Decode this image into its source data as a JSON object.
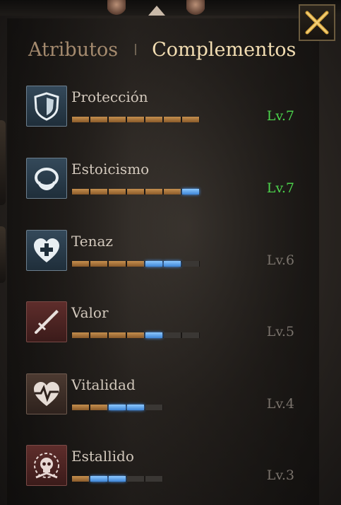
{
  "tabs": [
    {
      "label": "Atributos",
      "active": false
    },
    {
      "label": "Complementos",
      "active": true
    }
  ],
  "skills": [
    {
      "name": "Protección",
      "level": "Lv.7",
      "icon": "shield-icon",
      "theme": "blue",
      "gold": 7,
      "blue": 0,
      "total": 7,
      "maxed": true
    },
    {
      "name": "Estoicismo",
      "level": "Lv.7",
      "icon": "ring-icon",
      "theme": "blue",
      "gold": 6,
      "blue": 1,
      "total": 7,
      "maxed": true
    },
    {
      "name": "Tenaz",
      "level": "Lv.6",
      "icon": "heart-plus-icon",
      "theme": "blue",
      "gold": 4,
      "blue": 2,
      "total": 7,
      "maxed": false
    },
    {
      "name": "Valor",
      "level": "Lv.5",
      "icon": "sword-icon",
      "theme": "red",
      "gold": 4,
      "blue": 1,
      "total": 7,
      "maxed": false
    },
    {
      "name": "Vitalidad",
      "level": "Lv.4",
      "icon": "heartbeat-icon",
      "theme": "brown",
      "gold": 2,
      "blue": 2,
      "total": 5,
      "maxed": false
    },
    {
      "name": "Estallido",
      "level": "Lv.3",
      "icon": "skull-burst-icon",
      "theme": "red",
      "gold": 1,
      "blue": 2,
      "total": 5,
      "maxed": false
    }
  ],
  "colors": {
    "active_tab": "#f2ddb2",
    "inactive_tab": "#a48a6e",
    "max_level": "#4cd34c",
    "level": "#7a736c",
    "progress_gold": "#c58f4e",
    "progress_blue": "#4a9cff"
  }
}
